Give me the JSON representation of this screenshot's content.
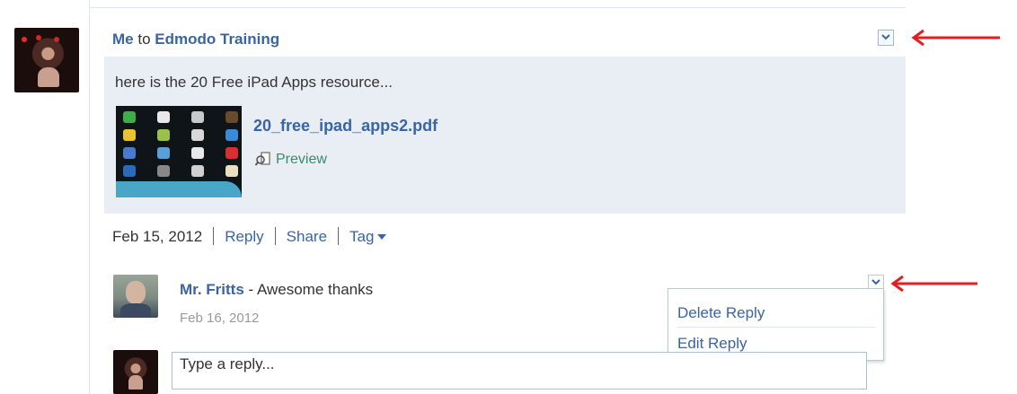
{
  "post": {
    "author": "Me",
    "to_word": "to",
    "recipient": "Edmodo Training",
    "message": "here is the 20 Free iPad Apps resource...",
    "attachment": {
      "filename": "20_free_ipad_apps2.pdf",
      "preview_label": "Preview"
    },
    "actions": {
      "date": "Feb 15, 2012",
      "reply_label": "Reply",
      "share_label": "Share",
      "tag_label": "Tag"
    }
  },
  "reply": {
    "author": "Mr. Fritts",
    "separator": " - ",
    "text": "Awesome thanks",
    "date": "Feb 16, 2012",
    "menu": {
      "delete_label": "Delete Reply",
      "edit_label": "Edit Reply"
    }
  },
  "composer": {
    "placeholder": "Type a reply..."
  },
  "colors": {
    "link": "#3a64a4",
    "message_bg": "#e9eef5",
    "annotation_arrow": "#e02020"
  },
  "icons": {
    "post_dropdown": "chevron-down-icon",
    "reply_dropdown": "chevron-down-icon",
    "preview": "preview-magnifier-icon",
    "tag_caret": "caret-down-icon",
    "annotation": "red-arrow-icon"
  }
}
